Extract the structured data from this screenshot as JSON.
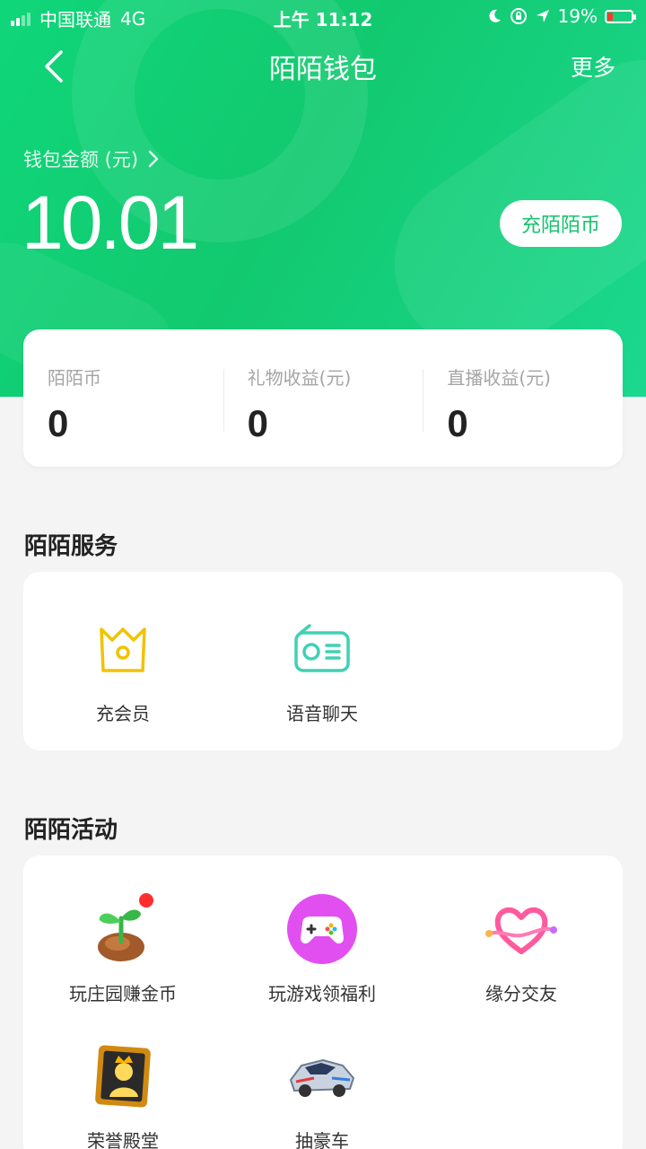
{
  "status_bar": {
    "carrier": "中国联通",
    "network": "4G",
    "time": "上午 11:12",
    "battery": "19%"
  },
  "nav": {
    "title": "陌陌钱包",
    "more_label": "更多"
  },
  "balance": {
    "label": "钱包金额 (元)",
    "amount": "10.01",
    "recharge_label": "充陌陌币"
  },
  "stats": [
    {
      "label": "陌陌币",
      "value": "0"
    },
    {
      "label": "礼物收益(元)",
      "value": "0"
    },
    {
      "label": "直播收益(元)",
      "value": "0"
    }
  ],
  "services": {
    "title": "陌陌服务",
    "items": [
      {
        "label": "充会员",
        "icon": "crown-icon"
      },
      {
        "label": "语音聊天",
        "icon": "radio-icon"
      }
    ]
  },
  "activities": {
    "title": "陌陌活动",
    "items": [
      {
        "label": "玩庄园赚金币",
        "icon": "sprout-icon"
      },
      {
        "label": "玩游戏领福利",
        "icon": "gamepad-icon"
      },
      {
        "label": "缘分交友",
        "icon": "heart-icon"
      },
      {
        "label": "荣誉殿堂",
        "icon": "honor-frame-icon"
      },
      {
        "label": "抽豪车",
        "icon": "race-car-icon"
      }
    ]
  },
  "colors": {
    "brand_green": "#12c96f",
    "crown_yellow": "#f2c200",
    "radio_teal": "#3fd1b4"
  }
}
